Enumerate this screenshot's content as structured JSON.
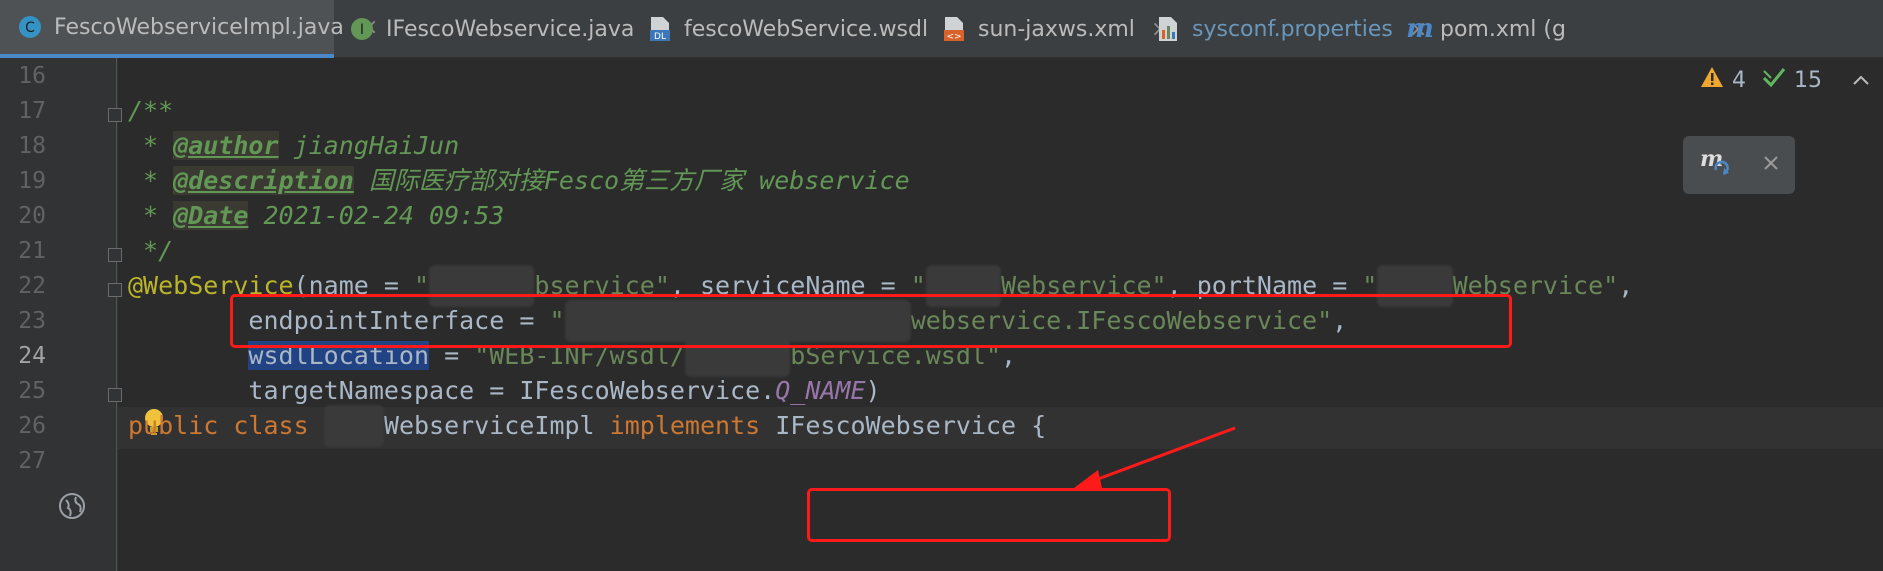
{
  "tabs": [
    {
      "label": "FescoWebserviceImpl.java",
      "icon": "class-c-icon",
      "active": true
    },
    {
      "label": "IFescoWebservice.java",
      "icon": "interface-i-icon",
      "active": false
    },
    {
      "label": "fescoWebService.wsdl",
      "icon": "wsdl-file-icon",
      "active": false
    },
    {
      "label": "sun-jaxws.xml",
      "icon": "xml-file-icon",
      "active": false
    },
    {
      "label": "sysconf.properties",
      "icon": "properties-file-icon",
      "active": false
    },
    {
      "label": "pom.xml (g",
      "icon": "maven-m-icon",
      "active": false
    }
  ],
  "tab_close": "×",
  "inspections": {
    "warnings": "4",
    "ok": "15"
  },
  "gutter": {
    "lines": [
      "16",
      "17",
      "18",
      "19",
      "20",
      "21",
      "22",
      "23",
      "24",
      "25",
      "26",
      "27"
    ],
    "current": "24"
  },
  "code": {
    "l17": "/**",
    "l18_star": " * ",
    "l18_tag": "@author",
    "l18_txt": " jiangHaiJun",
    "l19_star": " * ",
    "l19_tag": "@description",
    "l19_txt": " 国际医疗部对接Fesco第三方厂家 webservice",
    "l20_star": " * ",
    "l20_tag": "@Date",
    "l20_txt": " 2021-02-24 09:53",
    "l21": " */",
    "l22_ann": "@WebService",
    "l22_a": "(name = ",
    "l22_s1": "\"",
    "l22_s1b": "bservice\"",
    "l22_b": ", serviceName = ",
    "l22_s2": "\"",
    "l22_s2b": "Webservice\"",
    "l22_c": ", portName = ",
    "l22_s3": "\"",
    "l22_s3b": "Webservice\"",
    "l22_d": ",",
    "l23_a": "        endpointInterface = ",
    "l23_s": "\"",
    "l23_sb": "webservice.IFescoWebservice\"",
    "l23_c": ",",
    "l24_sel": "wsdlLocation",
    "l24_a": " = ",
    "l24_s": "\"WEB-INF/wsdl/",
    "l24_sb": "bService.wsdl\"",
    "l24_c": ",",
    "l25_a": "        targetNamespace = IFescoWebservice.",
    "l25_cst": "Q_NAME",
    "l25_b": ")",
    "l26_kw": "public class ",
    "l26_b": "WebserviceImpl ",
    "l26_kw2": "implements ",
    "l26_c": "IFescoWebservice {"
  },
  "colors": {
    "accent": "#4a88c7",
    "highlight": "#ff1a1a",
    "annotation": "#bbb529",
    "keyword": "#cc7832",
    "string": "#6a8759",
    "comment": "#629755"
  }
}
